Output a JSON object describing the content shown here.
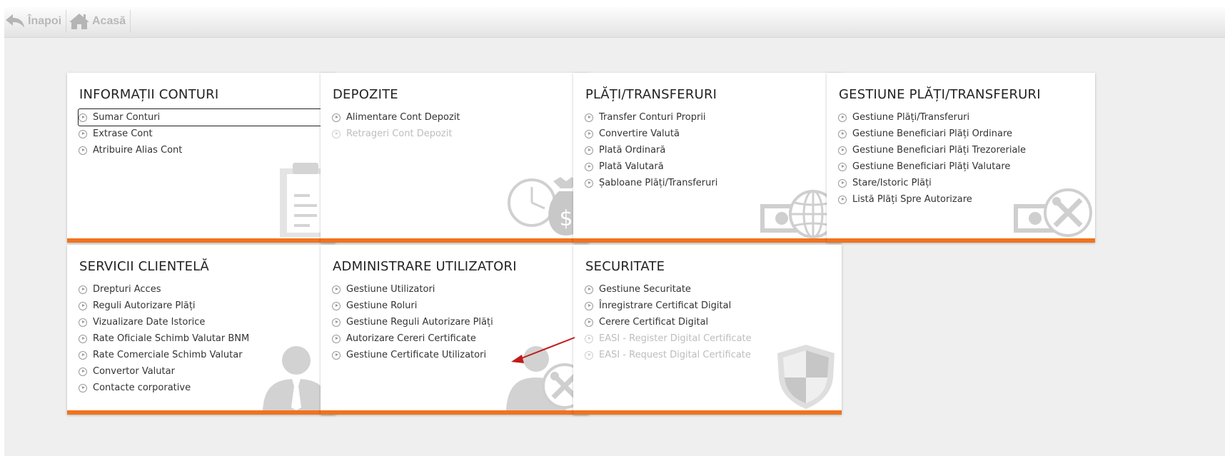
{
  "toolbar": {
    "back_label": "Înapoi",
    "home_label": "Acasă"
  },
  "accent_color": "#f0731e",
  "tiles": [
    {
      "title": "INFORMAȚII CONTURI",
      "icon": "clipboard-icon",
      "items": [
        {
          "label": "Sumar Conturi",
          "enabled": true,
          "focused": true
        },
        {
          "label": "Extrase Cont",
          "enabled": true
        },
        {
          "label": "Atribuire Alias Cont",
          "enabled": true
        }
      ]
    },
    {
      "title": "DEPOZITE",
      "icon": "clock-money-bag-icon",
      "items": [
        {
          "label": "Alimentare Cont Depozit",
          "enabled": true
        },
        {
          "label": "Retrageri Cont Depozit",
          "enabled": false
        }
      ]
    },
    {
      "title": "PLĂȚI/TRANSFERURI",
      "icon": "banknote-globe-icon",
      "items": [
        {
          "label": "Transfer Conturi Proprii",
          "enabled": true
        },
        {
          "label": "Convertire Valută",
          "enabled": true
        },
        {
          "label": "Plată Ordinară",
          "enabled": true
        },
        {
          "label": "Plată Valutară",
          "enabled": true
        },
        {
          "label": "Șabloane Plăți/Transferuri",
          "enabled": true
        }
      ]
    },
    {
      "title": "GESTIUNE PLĂȚI/TRANSFERURI",
      "icon": "banknote-tools-icon",
      "items": [
        {
          "label": "Gestiune Plăți/Transferuri",
          "enabled": true
        },
        {
          "label": "Gestiune Beneficiari Plăți Ordinare",
          "enabled": true
        },
        {
          "label": "Gestiune Beneficiari Plăți Trezoreriale",
          "enabled": true
        },
        {
          "label": "Gestiune Beneficiari Plăți Valutare",
          "enabled": true
        },
        {
          "label": "Stare/Istoric Plăți",
          "enabled": true
        },
        {
          "label": "Listă Plăți Spre Autorizare",
          "enabled": true
        }
      ]
    },
    {
      "title": "SERVICII CLIENTELĂ",
      "icon": "person-icon",
      "items": [
        {
          "label": "Drepturi Acces",
          "enabled": true
        },
        {
          "label": "Reguli Autorizare Plăți",
          "enabled": true
        },
        {
          "label": "Vizualizare Date Istorice",
          "enabled": true
        },
        {
          "label": "Rate Oficiale Schimb Valutar BNM",
          "enabled": true
        },
        {
          "label": "Rate Comerciale Schimb Valutar",
          "enabled": true
        },
        {
          "label": "Convertor Valutar",
          "enabled": true
        },
        {
          "label": "Contacte corporative",
          "enabled": true
        }
      ]
    },
    {
      "title": "ADMINISTRARE UTILIZATORI",
      "icon": "person-tools-icon",
      "items": [
        {
          "label": "Gestiune Utilizatori",
          "enabled": true
        },
        {
          "label": "Gestiune Roluri",
          "enabled": true
        },
        {
          "label": "Gestiune Reguli Autorizare Plăți",
          "enabled": true
        },
        {
          "label": "Autorizare Cereri Certificate",
          "enabled": true
        },
        {
          "label": "Gestiune Certificate Utilizatori",
          "enabled": true
        }
      ]
    },
    {
      "title": "SECURITATE",
      "icon": "shield-icon",
      "items": [
        {
          "label": "Gestiune Securitate",
          "enabled": true
        },
        {
          "label": "Înregistrare Certificat Digital",
          "enabled": true
        },
        {
          "label": "Cerere Certificat Digital",
          "enabled": true
        },
        {
          "label": "EASI - Register Digital Certificate",
          "enabled": false
        },
        {
          "label": "EASI - Request Digital Certificate",
          "enabled": false
        }
      ]
    }
  ]
}
